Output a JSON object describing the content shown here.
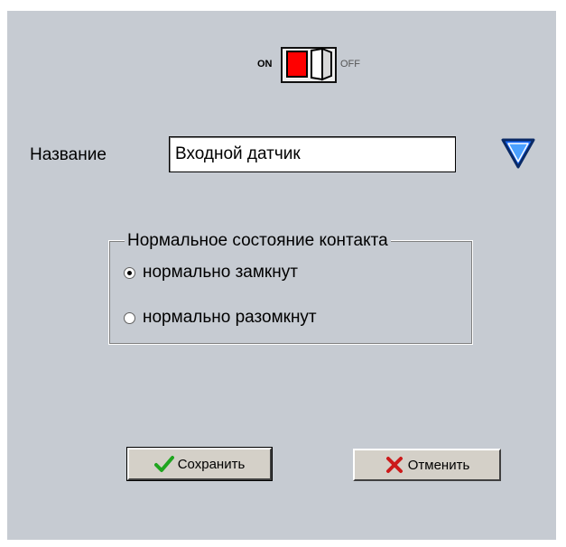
{
  "switch": {
    "on_label": "ON",
    "off_label": "OFF",
    "state": "on"
  },
  "name_field": {
    "label": "Название",
    "value": "Входной датчик"
  },
  "dropdown_icon": "triangle-down-icon",
  "contact_state": {
    "legend": "Нормальное состояние контакта",
    "options": [
      {
        "label": "нормально замкнут",
        "checked": true
      },
      {
        "label": "нормально разомкнут",
        "checked": false
      }
    ]
  },
  "buttons": {
    "save_label": "Сохранить",
    "save_icon": "checkmark-icon",
    "cancel_label": "Отменить",
    "cancel_icon": "cross-icon"
  },
  "colors": {
    "background": "#c6cbd2",
    "switch_red": "#ff0000",
    "dropdown_blue": "#1a6cff",
    "check_green": "#1fa51f",
    "cross_red": "#cc1a1a"
  }
}
